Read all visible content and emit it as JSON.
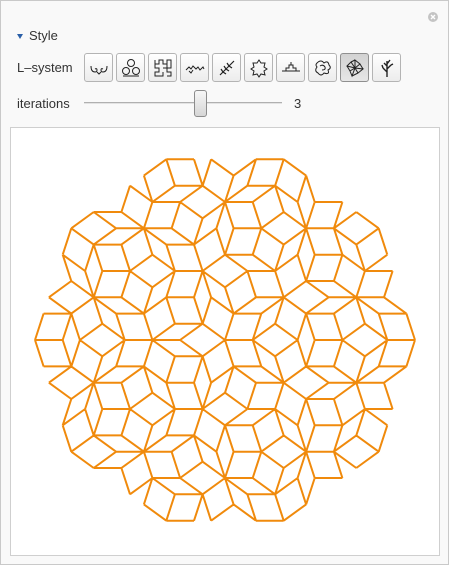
{
  "panel": {
    "section_title": "Style",
    "lsystem_label": "L–system",
    "iterations_label": "iterations",
    "iterations_value": "3",
    "iterations_min": 0,
    "iterations_max": 5,
    "selected_index": 8,
    "accent_color": "#f08a0c"
  },
  "buttons": [
    {
      "name": "lsystem-button-curl-icon",
      "icon": "curl-icon"
    },
    {
      "name": "lsystem-button-trefoil-icon",
      "icon": "trefoil-icon"
    },
    {
      "name": "lsystem-button-hilbert-icon",
      "icon": "hilbert-icon"
    },
    {
      "name": "lsystem-button-dragon-icon",
      "icon": "dragon-icon"
    },
    {
      "name": "lsystem-button-branch-icon",
      "icon": "branch-icon"
    },
    {
      "name": "lsystem-button-snowflake-icon",
      "icon": "snowflake-icon"
    },
    {
      "name": "lsystem-button-mound-icon",
      "icon": "mound-icon"
    },
    {
      "name": "lsystem-button-scribble-icon",
      "icon": "scribble-icon"
    },
    {
      "name": "lsystem-button-penrose-icon",
      "icon": "penrose-icon"
    },
    {
      "name": "lsystem-button-plant-icon",
      "icon": "plant-icon"
    }
  ]
}
